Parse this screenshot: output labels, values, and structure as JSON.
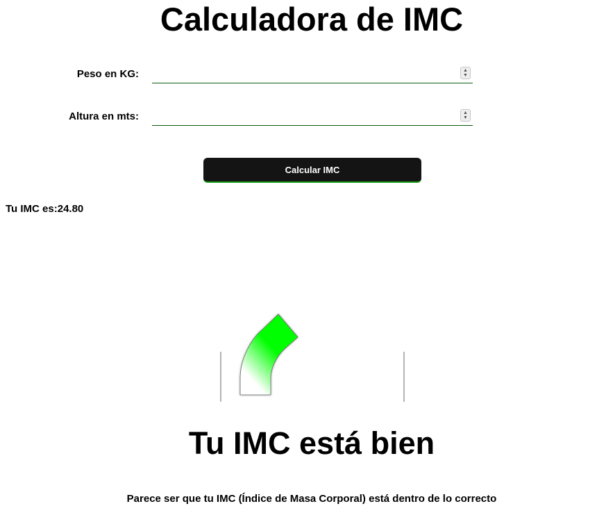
{
  "title": "Calculadora de IMC",
  "form": {
    "weight": {
      "label": "Peso en KG:",
      "value": "",
      "placeholder": ""
    },
    "height": {
      "label": "Altura en mts:",
      "value": "",
      "placeholder": ""
    },
    "submit_label": "Calcular IMC"
  },
  "result": {
    "text": "Tu IMC es:24.80",
    "bmi": 24.8
  },
  "gauge": {
    "indicator_color": "#00ff00",
    "status": "normal"
  },
  "verdict": {
    "heading": "Tu IMC está bien",
    "description": "Parece ser que tu IMC (Índice de Masa Corporal) está dentro de lo correcto"
  },
  "colors": {
    "button_bg": "#141414",
    "button_accent": "#1aa31a",
    "input_underline": "#0b5a0b"
  }
}
